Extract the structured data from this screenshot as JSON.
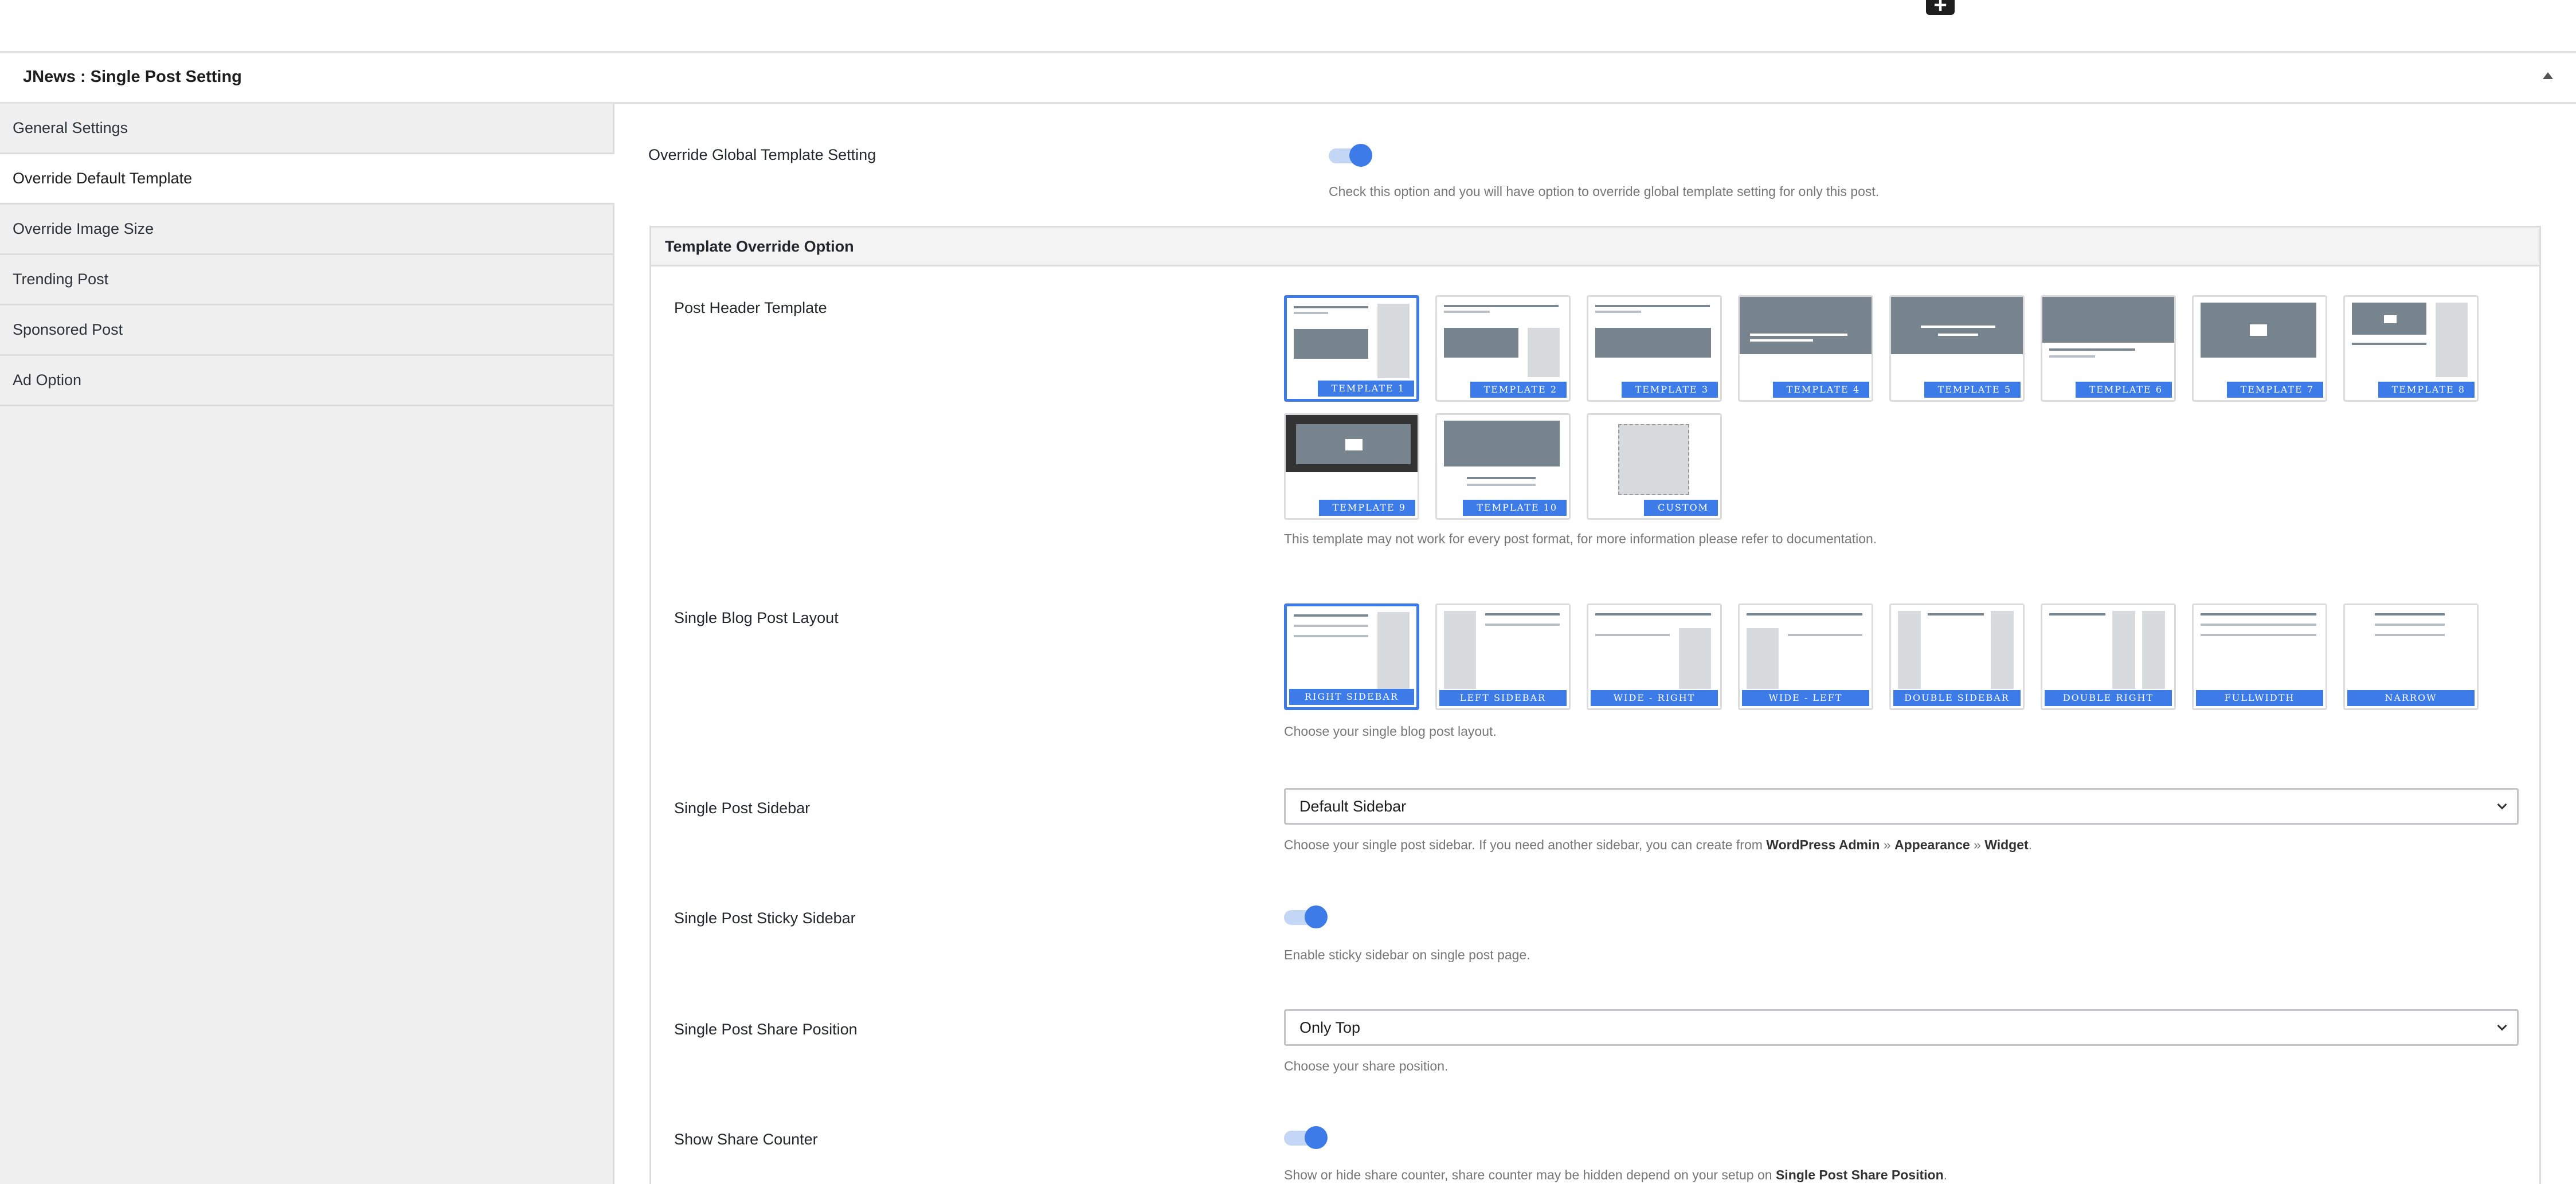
{
  "panel": {
    "title": "JNews : Single Post Setting"
  },
  "sidebar": {
    "items": [
      {
        "label": "General Settings"
      },
      {
        "label": "Override Default Template"
      },
      {
        "label": "Override Image Size"
      },
      {
        "label": "Trending Post"
      },
      {
        "label": "Sponsored Post"
      },
      {
        "label": "Ad Option"
      }
    ],
    "active_index": 1
  },
  "override_global": {
    "label": "Override Global Template Setting",
    "enabled": true,
    "description": "Check this option and you will have option to override global template setting for only this post."
  },
  "template_box": {
    "title": "Template Override Option"
  },
  "post_header": {
    "label": "Post Header Template",
    "options": [
      "TEMPLATE 1",
      "TEMPLATE 2",
      "TEMPLATE 3",
      "TEMPLATE 4",
      "TEMPLATE 5",
      "TEMPLATE 6",
      "TEMPLATE 7",
      "TEMPLATE 8",
      "TEMPLATE 9",
      "TEMPLATE 10",
      "CUSTOM"
    ],
    "selected": "TEMPLATE 1",
    "description": "This template may not work for every post format, for more information please refer to documentation."
  },
  "post_layout": {
    "label": "Single Blog Post Layout",
    "options": [
      "RIGHT SIDEBAR",
      "LEFT SIDEBAR",
      "WIDE - RIGHT SIDEBAR",
      "WIDE - LEFT SIDEBAR",
      "DOUBLE SIDEBAR",
      "DOUBLE RIGHT SIDEBAR",
      "FULLWIDTH",
      "NARROW"
    ],
    "selected": "RIGHT SIDEBAR",
    "description": "Choose your single blog post layout."
  },
  "post_sidebar": {
    "label": "Single Post Sidebar",
    "value": "Default Sidebar",
    "desc_prefix": "Choose your single post sidebar. If you need another sidebar, you can create from ",
    "desc_link1": "WordPress Admin",
    "desc_sep1": " » ",
    "desc_link2": "Appearance",
    "desc_sep2": " » ",
    "desc_link3": "Widget",
    "desc_suffix": "."
  },
  "sticky_sidebar": {
    "label": "Single Post Sticky Sidebar",
    "enabled": true,
    "description": "Enable sticky sidebar on single post page."
  },
  "share_position": {
    "label": "Single Post Share Position",
    "value": "Only Top",
    "description": "Choose your share position."
  },
  "share_counter": {
    "label": "Show Share Counter",
    "enabled": true,
    "desc_prefix": "Show or hide share counter, share counter may be hidden depend on your setup on ",
    "desc_bold": "Single Post Share Position",
    "desc_suffix": "."
  },
  "colors": {
    "accent": "#3c7be8",
    "sidebar_bg": "#f0f0f1",
    "border": "#dcdcde"
  }
}
